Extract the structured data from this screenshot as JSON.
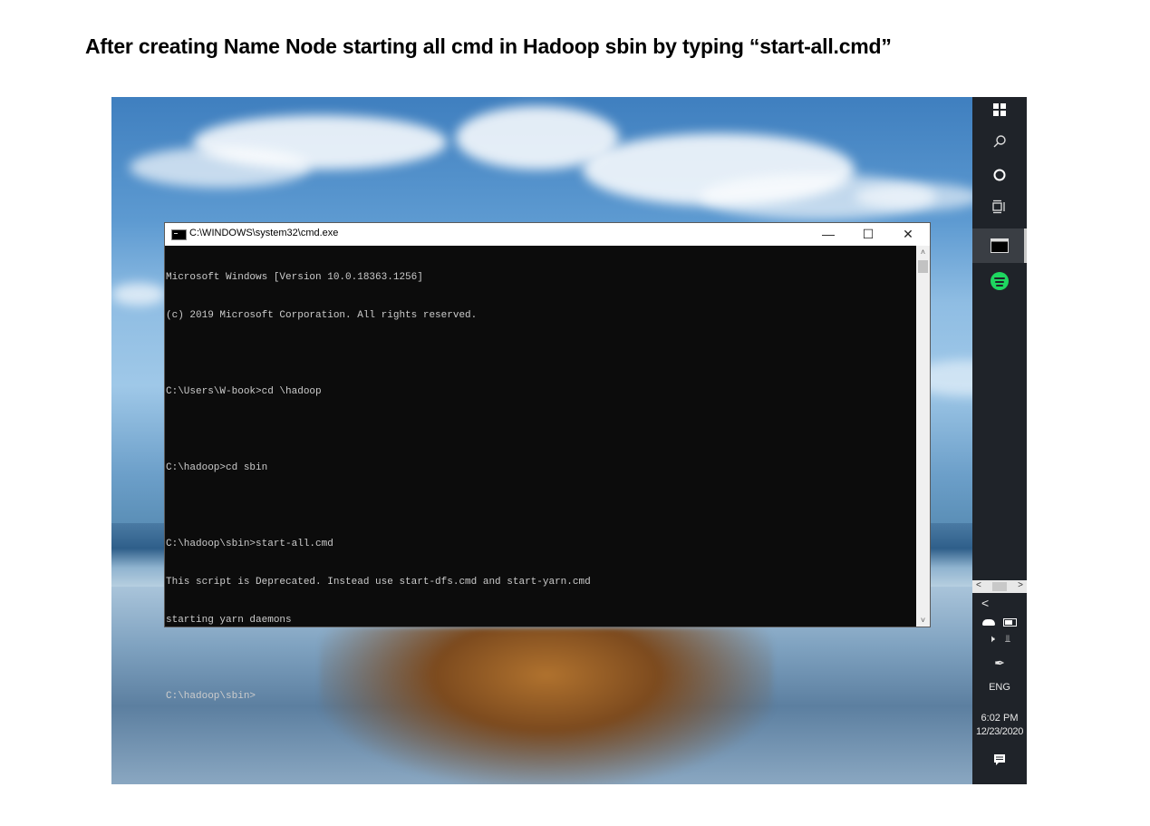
{
  "caption": "After creating Name Node starting all cmd in Hadoop sbin by typing “start-all.cmd”",
  "window": {
    "title": "C:\\WINDOWS\\system32\\cmd.exe",
    "minimize_icon": "—",
    "maximize_icon": "☐",
    "close_icon": "✕"
  },
  "console": {
    "lines": [
      "Microsoft Windows [Version 10.0.18363.1256]",
      "(c) 2019 Microsoft Corporation. All rights reserved.",
      "",
      "C:\\Users\\W-book>cd \\hadoop",
      "",
      "C:\\hadoop>cd sbin",
      "",
      "C:\\hadoop\\sbin>start-all.cmd",
      "This script is Deprecated. Instead use start-dfs.cmd and start-yarn.cmd",
      "starting yarn daemons",
      "",
      "C:\\hadoop\\sbin>"
    ]
  },
  "taskbar": {
    "start_icon": "windows-start-icon",
    "search_icon": "search-icon",
    "cortana_icon": "cortana-icon",
    "taskview_icon": "task-view-icon",
    "language": "ENG",
    "time": "6:02 PM",
    "date": "12/23/2020"
  },
  "colors": {
    "console_bg": "#0c0c0c",
    "console_fg": "#cccccc",
    "taskbar_bg": "#1f2329",
    "spotify": "#1ed760"
  }
}
